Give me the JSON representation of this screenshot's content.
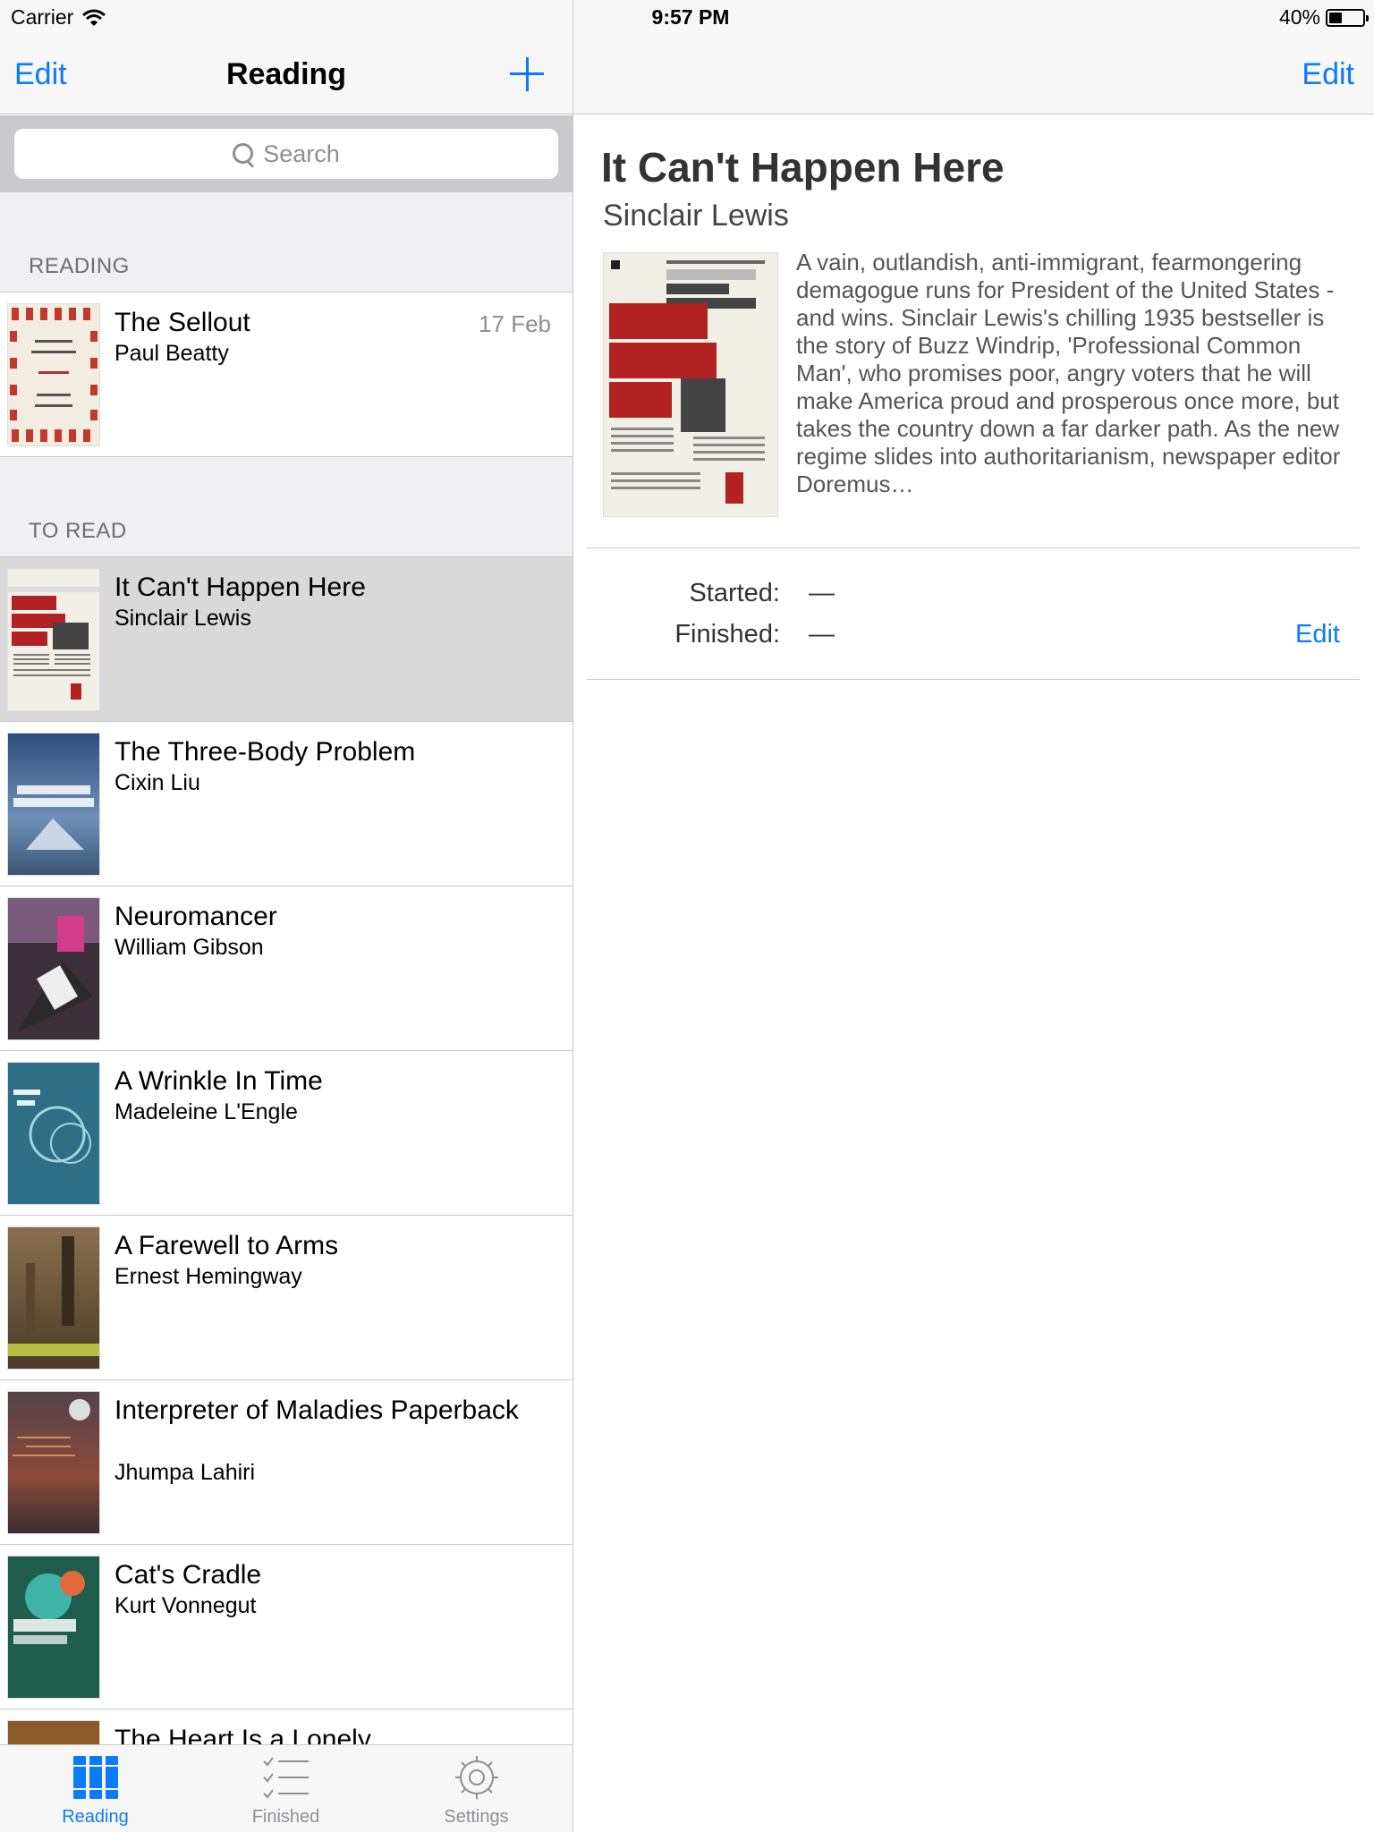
{
  "status_bar": {
    "carrier": "Carrier",
    "time": "9:57 PM",
    "battery": "40%",
    "battery_level": 0.4
  },
  "master": {
    "nav": {
      "edit": "Edit",
      "title": "Reading",
      "add_icon": "plus-icon"
    },
    "search": {
      "placeholder": "Search"
    },
    "sections": {
      "reading": "READING",
      "to_read": "TO READ"
    },
    "reading_items": [
      {
        "title": "The Sellout",
        "author": "Paul Beatty",
        "date": "17 Feb"
      }
    ],
    "to_read_items": [
      {
        "title": "It Can't Happen Here",
        "author": "Sinclair Lewis"
      },
      {
        "title": "The Three-Body Problem",
        "author": "Cixin Liu"
      },
      {
        "title": "Neuromancer",
        "author": "William Gibson"
      },
      {
        "title": "A Wrinkle In Time",
        "author": "Madeleine L'Engle"
      },
      {
        "title": "A Farewell to Arms",
        "author": "Ernest Hemingway"
      },
      {
        "title": "Interpreter of Maladies Paperback",
        "author": "Jhumpa Lahiri"
      },
      {
        "title": "Cat's Cradle",
        "author": "Kurt Vonnegut"
      },
      {
        "title": "The Heart Is a Lonely",
        "author": ""
      }
    ],
    "tabs": [
      {
        "label": "Reading",
        "icon": "books-icon",
        "active": true
      },
      {
        "label": "Finished",
        "icon": "checklist-icon",
        "active": false
      },
      {
        "label": "Settings",
        "icon": "gear-icon",
        "active": false
      }
    ]
  },
  "detail": {
    "nav": {
      "edit": "Edit"
    },
    "title": "It Can't Happen Here",
    "author": "Sinclair Lewis",
    "description": "A vain, outlandish, anti-immigrant, fearmongering demagogue runs for President of the United States - and wins. Sinclair Lewis's chilling 1935 bestseller is the story of Buzz Windrip, 'Professional Common Man', who promises poor, angry voters that he will make America proud and prosperous once more, but takes the country down a far darker path. As the new regime slides into authoritarianism, newspaper editor Doremus…",
    "started_label": "Started:",
    "started_value": "—",
    "finished_label": "Finished:",
    "finished_value": "—",
    "edit_link": "Edit"
  },
  "colors": {
    "accent": "#0a7aff",
    "selected_row": "#d9d9d9",
    "section_bg": "#efeff4"
  }
}
